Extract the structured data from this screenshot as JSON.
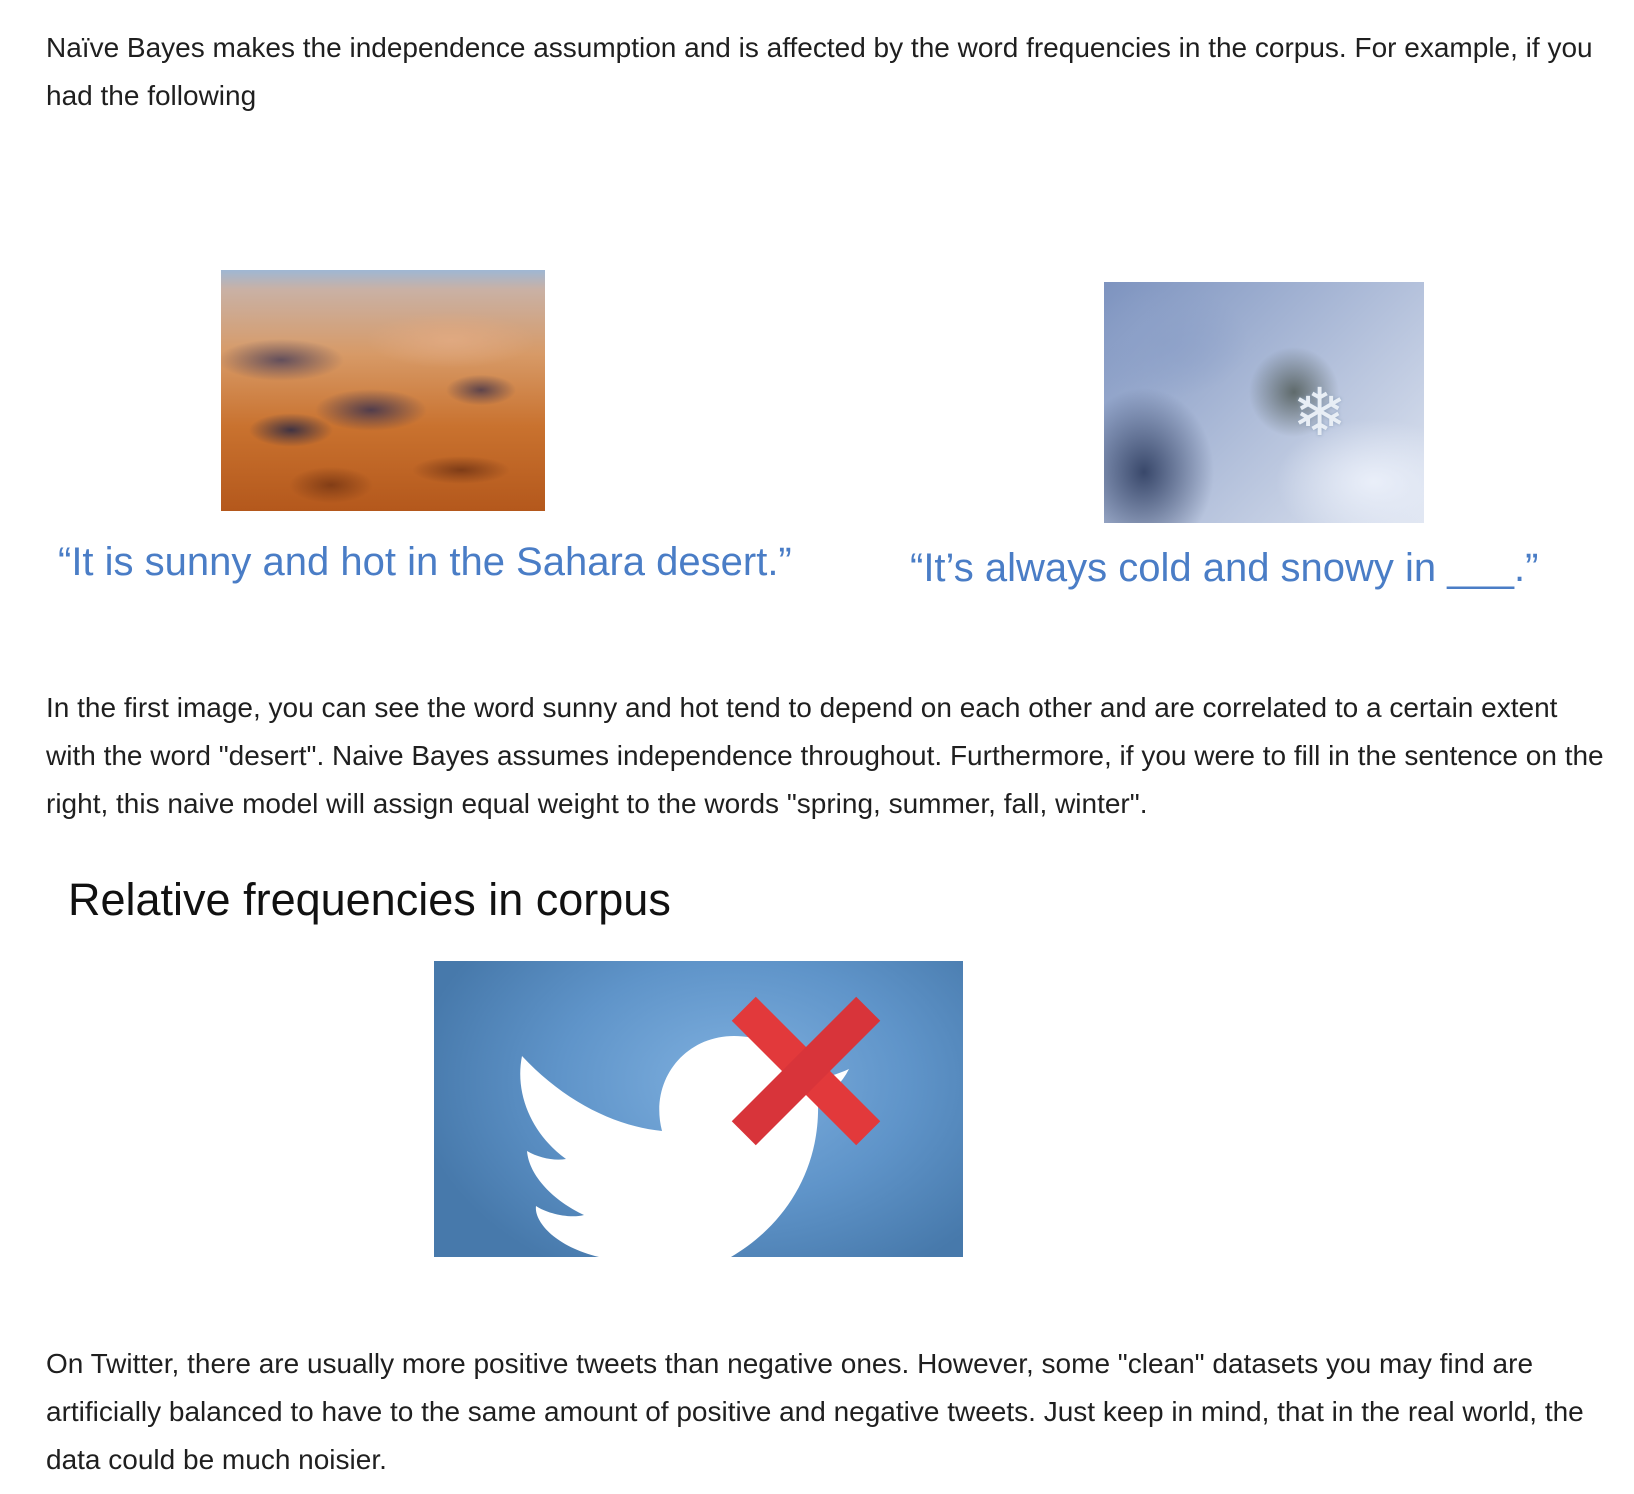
{
  "intro": {
    "text": "Naïve Bayes makes the independence assumption and is affected by the word frequencies in the corpus. For example, if you had the following"
  },
  "examples": {
    "left_image_alt": "desert-aerial-photo",
    "left_quote": "“It is sunny and hot in the Sahara desert.”",
    "right_image_alt": "snowflake-photo",
    "right_quote": "“It’s always cold and snowy in ___.”"
  },
  "explanation": {
    "text": "In the first image, you can see the word sunny and hot tend to depend on each other and are correlated to a certain extent with the word \"desert\". Naive Bayes assumes independence throughout. Furthermore, if you were to fill in the sentence on the right, this naive model will assign equal weight to the words \"spring, summer, fall, winter\"."
  },
  "section": {
    "heading": "Relative frequencies in corpus"
  },
  "twitter_figure": {
    "icon": "twitter-bird-crossed-out",
    "colors": {
      "background": "#5f94c9",
      "bird": "#ffffff",
      "cross": "#e2393b"
    }
  },
  "closing": {
    "text": "On Twitter, there are usually more positive tweets than negative ones. However, some \"clean\" datasets you may find are artificially balanced to have to the same amount of positive and negative tweets. Just keep in mind, that in the real world, the data could be much noisier."
  },
  "colors": {
    "quote": "#4a7dc6",
    "body_text": "#1f1f1f"
  }
}
